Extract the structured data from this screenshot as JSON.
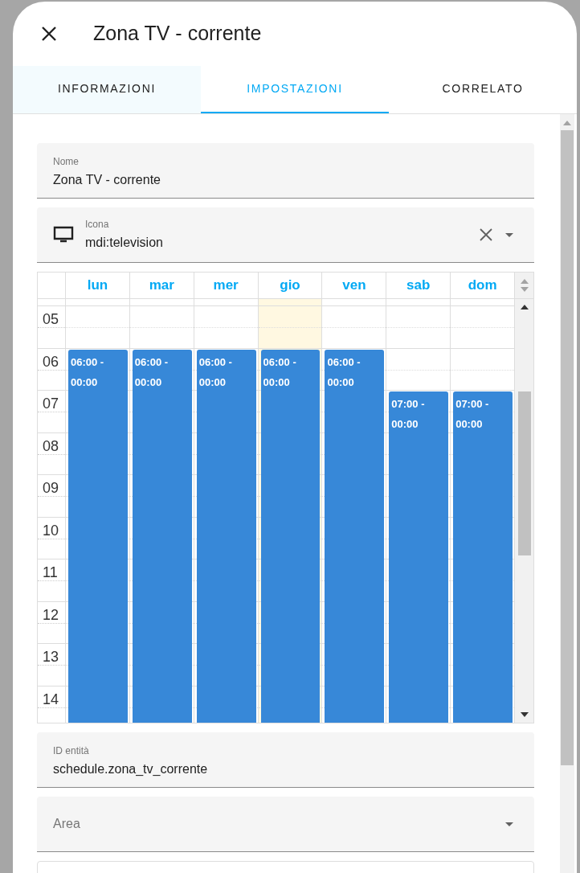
{
  "dialog": {
    "title": "Zona TV - corrente"
  },
  "tabs": [
    {
      "label": "INFORMAZIONI",
      "selected": false,
      "highlighted": true
    },
    {
      "label": "IMPOSTAZIONI",
      "selected": true,
      "highlighted": false
    },
    {
      "label": "CORRELATO",
      "selected": false,
      "highlighted": false
    }
  ],
  "name_field": {
    "label": "Nome",
    "value": "Zona TV - corrente"
  },
  "icon_field": {
    "label": "Icona",
    "value": "mdi:television"
  },
  "schedule": {
    "days": [
      {
        "label": "lun",
        "today": false
      },
      {
        "label": "mar",
        "today": false
      },
      {
        "label": "mer",
        "today": false
      },
      {
        "label": "gio",
        "today": true
      },
      {
        "label": "ven",
        "today": false
      },
      {
        "label": "sab",
        "today": false
      },
      {
        "label": "dom",
        "today": false
      }
    ],
    "hours": [
      {
        "label": "05"
      },
      {
        "label": "06",
        "cells": [
          {
            "start": "06:00 -",
            "end": "00:00"
          },
          {
            "start": "06:00 -",
            "end": "00:00"
          },
          {
            "start": "06:00 -",
            "end": "00:00"
          },
          {
            "start": "06:00 -",
            "end": "00:00"
          },
          {
            "start": "06:00 -",
            "end": "00:00"
          },
          null,
          null
        ]
      },
      {
        "label": "07",
        "cells": [
          null,
          null,
          null,
          null,
          null,
          {
            "start": "07:00 -",
            "end": "00:00"
          },
          {
            "start": "07:00 -",
            "end": "00:00"
          }
        ]
      },
      {
        "label": "08"
      },
      {
        "label": "09"
      },
      {
        "label": "10"
      },
      {
        "label": "11"
      },
      {
        "label": "12"
      },
      {
        "label": "13"
      },
      {
        "label": "14"
      }
    ]
  },
  "entity_id_field": {
    "label": "ID entità",
    "value": "schedule.zona_tv_corrente"
  },
  "area_field": {
    "label": "Area"
  }
}
